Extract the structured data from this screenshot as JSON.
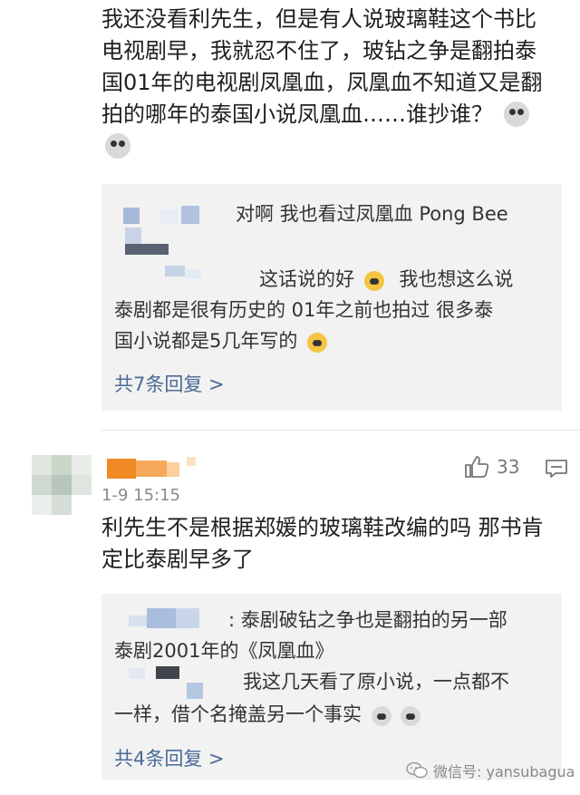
{
  "comment1": {
    "text": "我还没看利先生，但是有人说玻璃鞋这个书比电视剧早，我就忍不住了，玻钻之争是翻拍泰国01年的电视剧凤凰血，凤凰血不知道又是翻拍的哪年的泰国小说凤凰血……谁抄谁？",
    "replies": [
      "对啊 我也看过凤凰血 Pong Bee",
      "这话说的好",
      "我也想这么说",
      "泰剧都是很有历史的 01年之前也拍过  很多泰",
      "国小说都是5几年写的"
    ],
    "more": "共7条回复 >"
  },
  "comment2": {
    "timestamp": "1-9 15:15",
    "likes": "33",
    "text": "利先生不是根据郑媛的玻璃鞋改编的吗 那书肯定比泰剧早多了",
    "replies": [
      ": 泰剧破钻之争也是翻拍的另一部",
      "泰剧2001年的《凤凰血》",
      "我这几天看了原小说，一点都不",
      "一样，借个名掩盖另一个事实"
    ],
    "more": "共4条回复 >"
  },
  "watermark": "微信号: yansubagua",
  "colors": {
    "link": "#4a6a95",
    "reply_bg": "#f2f2f2",
    "name_mosaic": "#f08a24"
  }
}
